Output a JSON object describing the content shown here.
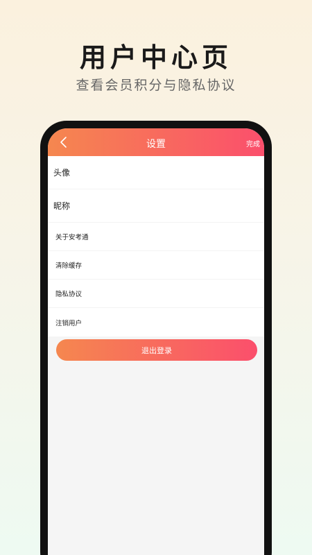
{
  "promo": {
    "title": "用户中心页",
    "subtitle": "查看会员积分与隐私协议"
  },
  "navbar": {
    "back_icon": "chevron-left-icon",
    "title": "设置",
    "done_label": "完成",
    "gradient_start": "#f5874f",
    "gradient_end": "#fb4f6c"
  },
  "settings": {
    "items": [
      {
        "label": "头像"
      },
      {
        "label": "昵称"
      },
      {
        "label": "关于安考通"
      },
      {
        "label": "清除缓存"
      },
      {
        "label": "隐私协议"
      },
      {
        "label": "注销用户"
      }
    ]
  },
  "logout": {
    "label": "退出登录"
  }
}
